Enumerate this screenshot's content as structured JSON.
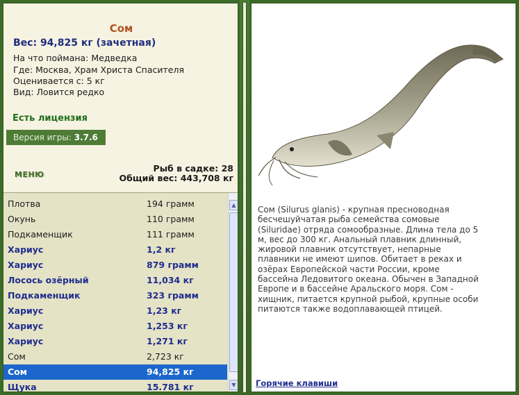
{
  "fish": {
    "name": "Сом",
    "weight_line": "Вес: 94,825 кг (зачетная)",
    "caught_with": "На что поймана: Медведка",
    "location": "Где: Москва, Храм Христа Спасителя",
    "valued_from": "Оценивается с: 5 кг",
    "species_note": "Вид: Ловится редко"
  },
  "license": "Есть лицензия",
  "version": {
    "label": "Версия игры:",
    "value": "3.7.6"
  },
  "menu_label": "МЕНЮ",
  "stats": {
    "fish_in_keepnet": "Рыб в садке: 28",
    "total_weight": "Общий вес: 443,708 кг"
  },
  "catch_list": [
    {
      "name": "Плотва",
      "weight": "194 грамм",
      "style": "plain"
    },
    {
      "name": "Окунь",
      "weight": "110 грамм",
      "style": "plain"
    },
    {
      "name": "Подкаменщик",
      "weight": "111 грамм",
      "style": "plain"
    },
    {
      "name": "Хариус",
      "weight": "1,2 кг",
      "style": "bold"
    },
    {
      "name": "Хариус",
      "weight": "879 грамм",
      "style": "bold"
    },
    {
      "name": "Лосось озёрный",
      "weight": "11,034 кг",
      "style": "bold"
    },
    {
      "name": "Подкаменщик",
      "weight": "323 грамм",
      "style": "bold"
    },
    {
      "name": "Хариус",
      "weight": "1,23 кг",
      "style": "bold"
    },
    {
      "name": "Хариус",
      "weight": "1,253 кг",
      "style": "bold"
    },
    {
      "name": "Хариус",
      "weight": "1,271 кг",
      "style": "bold"
    },
    {
      "name": "Сом",
      "weight": "2,723 кг",
      "style": "plain"
    },
    {
      "name": "Сом",
      "weight": "94,825 кг",
      "style": "selected"
    },
    {
      "name": "Щука",
      "weight": "15.781 кг",
      "style": "bold"
    }
  ],
  "description": "Сом (Silurus glanis) - крупная пресноводная бесчешуйчатая рыба семейства сомовые (Siluridae) отряда сомообразные. Длина тела до 5 м, вес до 300 кг. Анальный плавник длинный, жировой плавник отсутствует, непарные плавники не имеют шипов. Обитает в реках и озёрах Европейской части России, кроме бассейна Ледовитого океана. Обычен в Западной Европе и в бассейне Аральского моря. Сом - хищник, питается крупной рыбой, крупные особи питаются также водоплавающей птицей.",
  "hotkeys_label": "Горячие клавиши",
  "colors": {
    "frame_green": "#3c6a28",
    "selected_row": "#1c67cd",
    "fish_title": "#b2521e",
    "link_blue": "#1f2d8e"
  }
}
